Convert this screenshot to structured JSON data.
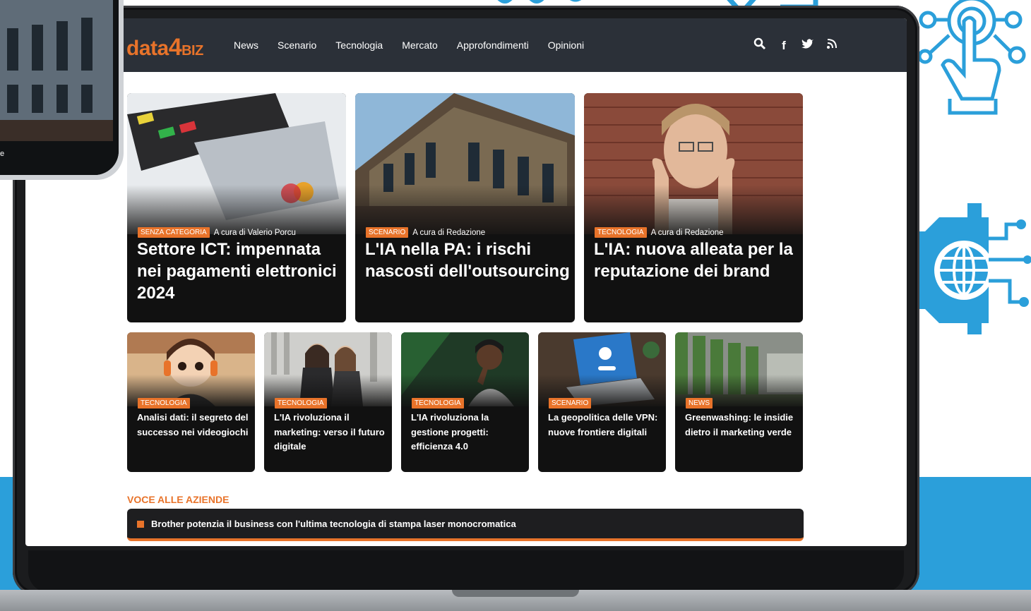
{
  "site": {
    "logo": {
      "part1": "data",
      "part2": "4",
      "part3": "BIZ"
    },
    "nav": [
      "News",
      "Scenario",
      "Tecnologia",
      "Mercato",
      "Approfondimenti",
      "Opinioni"
    ],
    "icons": [
      "search-icon",
      "facebook-icon",
      "twitter-icon",
      "rss-icon"
    ],
    "icon_glyphs": {
      "search": "⚲",
      "facebook": "f",
      "twitter": "🐦",
      "rss": "⟆"
    }
  },
  "featured": [
    {
      "category": "SENZA CATEGORIA",
      "author": "A cura di Valerio Porcu",
      "title": "Settore ICT: impennata nei pagamenti elettronici 2024"
    },
    {
      "category": "SCENARIO",
      "author": "A cura di Redazione",
      "title": "L'IA nella PA: i rischi nascosti dell'outsourcing"
    },
    {
      "category": "TECNOLOGIA",
      "author": "A cura di Redazione",
      "title": "L'IA: nuova alleata per la reputazione dei brand"
    }
  ],
  "secondary": [
    {
      "category": "TECNOLOGIA",
      "title": "Analisi dati: il segreto del successo nei videogiochi"
    },
    {
      "category": "TECNOLOGIA",
      "title": "L'IA rivoluziona il marketing: verso il futuro digitale"
    },
    {
      "category": "TECNOLOGIA",
      "title": "L'IA rivoluziona la gestione progetti: efficienza 4.0"
    },
    {
      "category": "SCENARIO",
      "title": "La geopolitica delle VPN: nuove frontiere digitali"
    },
    {
      "category": "NEWS",
      "title": "Greenwashing: le insidie dietro il marketing verde"
    }
  ],
  "voce": {
    "section_title": "VOCE ALLE AZIENDE",
    "item": "Brother potenzia il business con l'ultima tecnologia di stampa laser monocromatica"
  },
  "phone": {
    "text": "e"
  },
  "colors": {
    "accent": "#e8732a",
    "navbar": "#2b3038",
    "brand_blue": "#2b9fda",
    "card": "#111111"
  }
}
